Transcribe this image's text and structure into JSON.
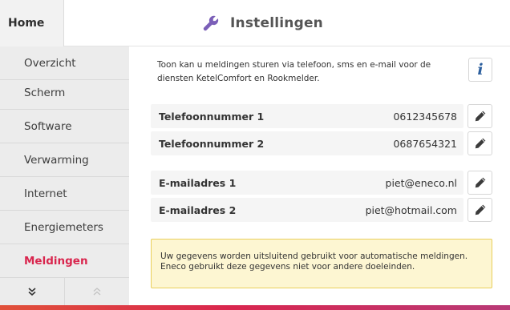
{
  "header": {
    "home_label": "Home",
    "title": "Instellingen",
    "title_icon": "wrench-icon"
  },
  "sidebar": {
    "items": [
      {
        "label": "Overzicht",
        "active": false
      },
      {
        "label": "Scherm",
        "active": false
      },
      {
        "label": "Software",
        "active": false
      },
      {
        "label": "Verwarming",
        "active": false
      },
      {
        "label": "Internet",
        "active": false
      },
      {
        "label": "Energiemeters",
        "active": false
      },
      {
        "label": "Meldingen",
        "active": true
      }
    ],
    "nav_down": "⌄",
    "nav_up": "⌃",
    "active_color": "#d9264e"
  },
  "main": {
    "intro": "Toon kan u meldingen sturen via telefoon, sms en e-mail voor de diensten KetelComfort en Rookmelder.",
    "info_label": "i",
    "phones": [
      {
        "label": "Telefoonnummer 1",
        "value": "0612345678"
      },
      {
        "label": "Telefoonnummer 2",
        "value": "0687654321"
      }
    ],
    "emails": [
      {
        "label": "E-mailadres 1",
        "value": "piet@eneco.nl"
      },
      {
        "label": "E-mailadres 2",
        "value": "piet@hotmail.com"
      }
    ],
    "notice_line1": "Uw gegevens worden uitsluitend gebruikt voor automatische meldingen.",
    "notice_line2": "Eneco gebruikt deze gegevens niet voor andere doeleinden."
  }
}
